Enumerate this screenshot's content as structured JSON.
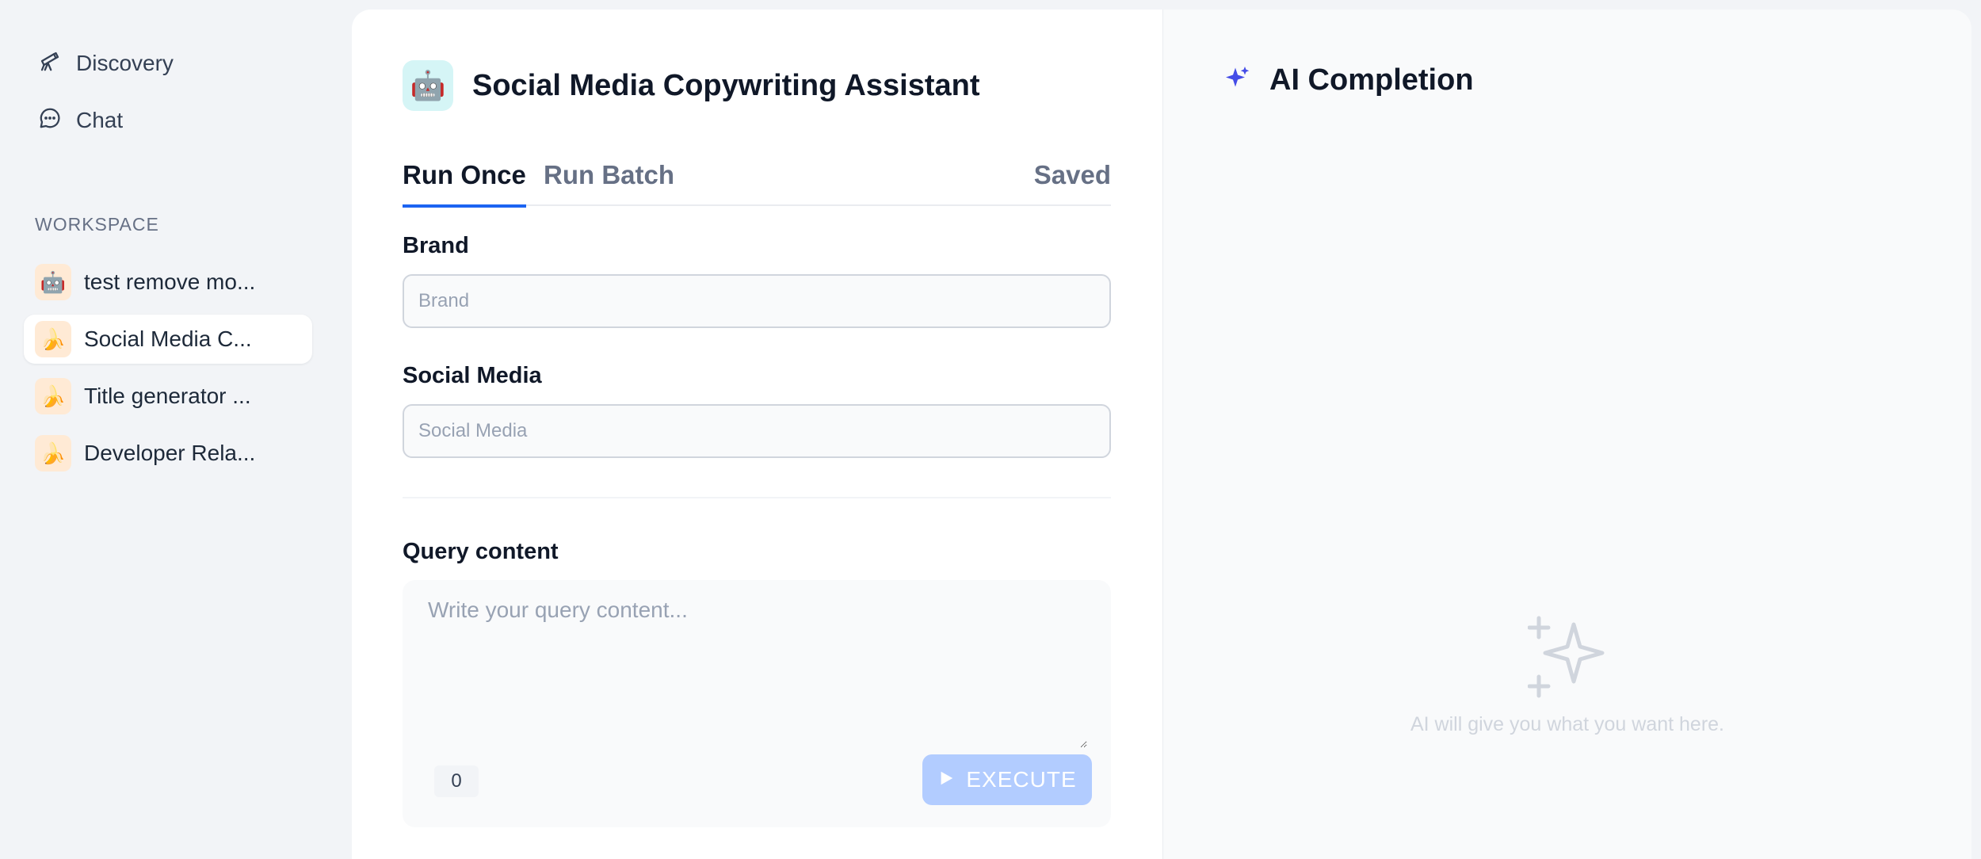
{
  "sidebar": {
    "nav": [
      {
        "label": "Discovery",
        "icon": "telescope-icon"
      },
      {
        "label": "Chat",
        "icon": "chat-bubble-icon"
      }
    ],
    "workspace_title": "WORKSPACE",
    "items": [
      {
        "label": "test remove mo...",
        "emoji": "🤖",
        "active": false
      },
      {
        "label": "Social Media C...",
        "emoji": "🍌",
        "active": true
      },
      {
        "label": "Title generator ...",
        "emoji": "🍌",
        "active": false
      },
      {
        "label": "Developer Rela...",
        "emoji": "🍌",
        "active": false
      }
    ]
  },
  "app": {
    "emoji": "🤖",
    "title": "Social Media Copywriting Assistant",
    "tabs": [
      {
        "label": "Run Once",
        "active": true
      },
      {
        "label": "Run Batch",
        "active": false
      }
    ],
    "saved_label": "Saved",
    "fields": [
      {
        "label": "Brand",
        "placeholder": "Brand",
        "value": ""
      },
      {
        "label": "Social Media",
        "placeholder": "Social Media",
        "value": ""
      }
    ],
    "query": {
      "label": "Query content",
      "placeholder": "Write your query content...",
      "value": "",
      "char_count": "0",
      "execute_label": "EXECUTE"
    }
  },
  "completion": {
    "title": "AI Completion",
    "empty_text": "AI will give you what you want here."
  },
  "colors": {
    "accent": "#1c64f2",
    "execute_disabled": "#b2ccff",
    "sparkle": "#444ce7",
    "workspace_icon_bg": "#ffead5",
    "app_icon_bg": "#d5f5f6"
  }
}
